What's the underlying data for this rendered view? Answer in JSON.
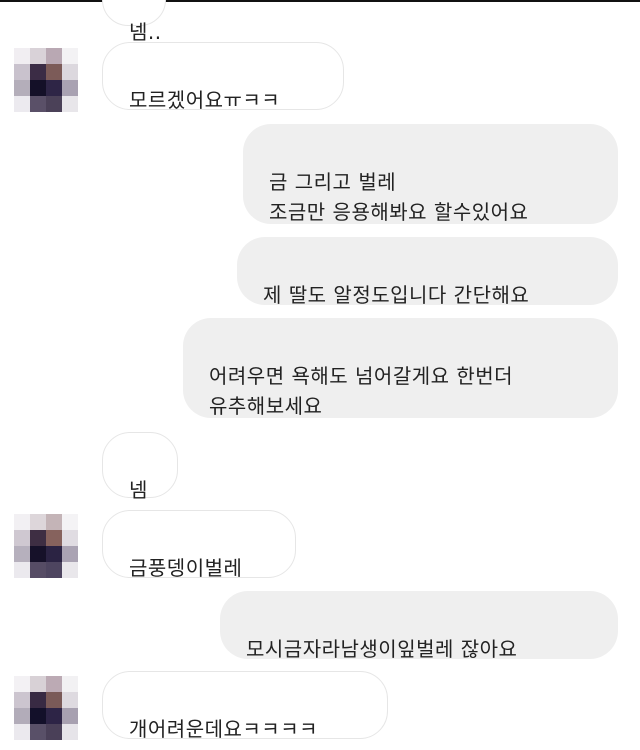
{
  "messages": [
    {
      "id": "m0",
      "side": "in",
      "text": "넴.."
    },
    {
      "id": "m1",
      "side": "in",
      "text": "모르겠어요ㅠㅋㅋ",
      "avatar": true
    },
    {
      "id": "m2",
      "side": "out",
      "text": "금 그리고 벌레\n조금만 응용해봐요 할수있어요"
    },
    {
      "id": "m3",
      "side": "out",
      "text": "제 딸도 알정도입니다 간단해요"
    },
    {
      "id": "m4",
      "side": "out",
      "text": "어려우면 욕해도 넘어갈게요 한번더\n유추해보세요"
    },
    {
      "id": "m5",
      "side": "in",
      "text": "넴"
    },
    {
      "id": "m6",
      "side": "in",
      "text": "금풍뎅이벌레",
      "avatar": true
    },
    {
      "id": "m7",
      "side": "out",
      "text": "모시금자라남생이잎벌레  잖아요"
    },
    {
      "id": "m8",
      "side": "in",
      "text": "개어려운데요ㅋㅋㅋㅋ",
      "avatar": true
    }
  ],
  "colors": {
    "incoming_bubble": "#ffffff",
    "incoming_border": "#e6e6e6",
    "outgoing_bubble": "#efefef",
    "text": "#222222"
  },
  "icons": {
    "avatar": "pixelated-avatar-icon"
  }
}
